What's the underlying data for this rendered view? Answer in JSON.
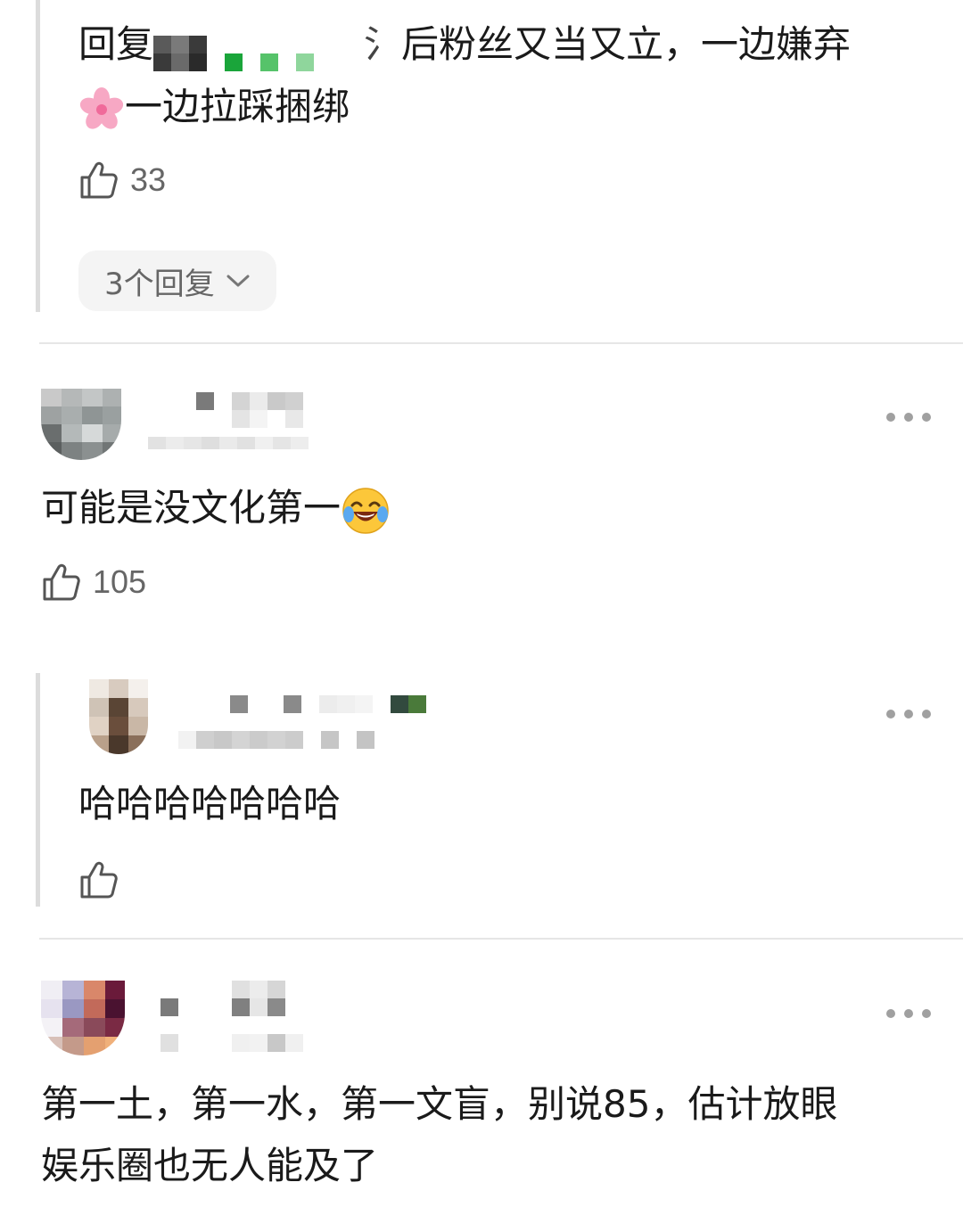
{
  "thread1": {
    "reply_prefix": "回复",
    "text_after_name": "后粉丝又当又立，一边嫌弃",
    "text_line2": "一边拉踩捆绑",
    "flower_emoji": "🌸",
    "likes": "33",
    "replies_label": "3个回复"
  },
  "comment2": {
    "text": "可能是没文化第一",
    "emoji": "laugh-cry",
    "likes": "105"
  },
  "reply2": {
    "text": "哈哈哈哈哈哈哈"
  },
  "comment3": {
    "text_line1": "第一土，第一水，第一文盲，别说85，估计放眼",
    "text_line2": "娱乐圈也无人能及了"
  },
  "colors": {
    "text": "#1a1a1a",
    "muted": "#666666",
    "divider": "#e6e6e6",
    "pill_bg": "#f4f4f4",
    "rule": "#dcdcdc"
  }
}
